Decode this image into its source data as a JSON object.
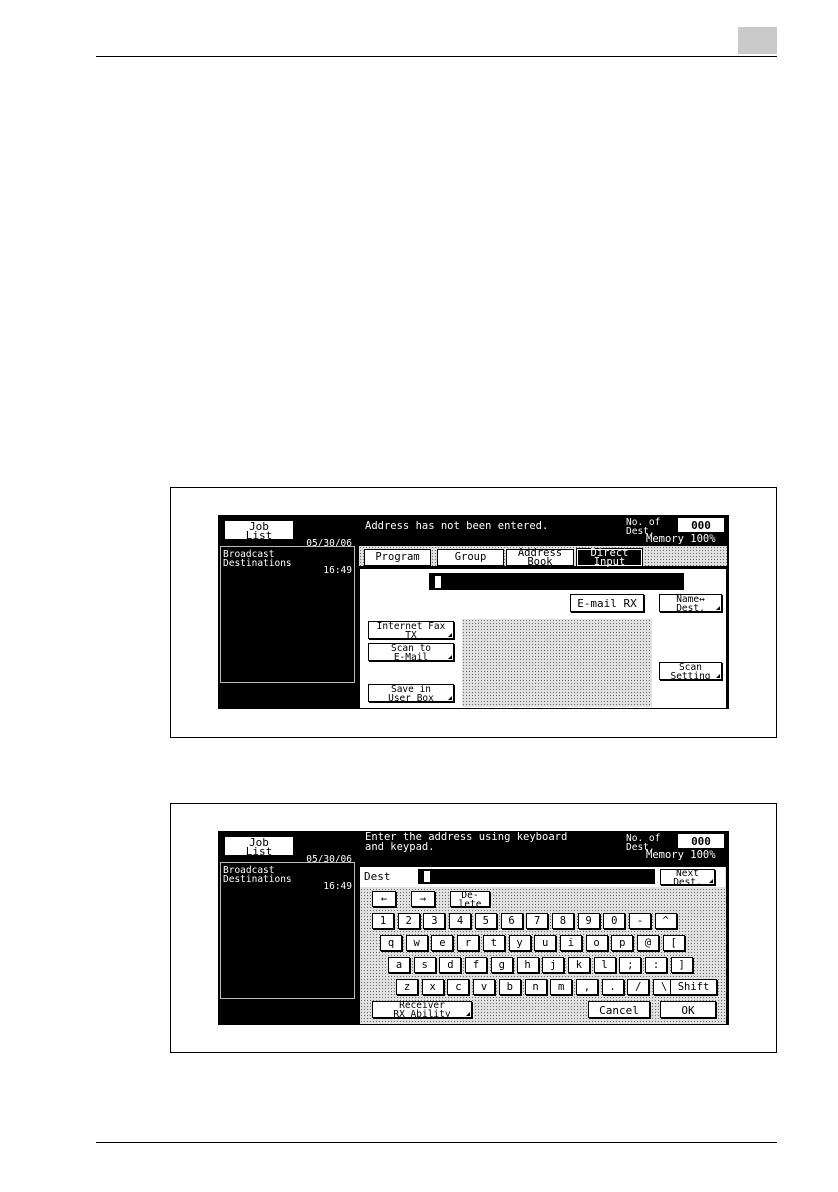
{
  "screen1": {
    "job_list": "Job\nList",
    "date": "05/30/06",
    "time": "16:49",
    "message": "Address has not been entered.",
    "no_of_dest_label": "No. of\nDest.",
    "dest_count": "000",
    "memory": "Memory 100%",
    "destinations_label": "Broadcast\nDestinations",
    "tabs": [
      "Program",
      "Group",
      "Address\nBook",
      "Direct\nInput"
    ],
    "email_rx": "E-mail RX",
    "name_dest": "Name↔\nDest.",
    "internet_fax": "Internet Fax\nTX",
    "scan_to_email": "Scan to\nE-Mail",
    "save_in_user_box": "Save in\nUser Box",
    "scan_setting": "Scan\nSetting"
  },
  "screen2": {
    "job_list": "Job\nList",
    "date": "05/30/06",
    "time": "16:49",
    "message": "Enter the address using keyboard\nand keypad.",
    "no_of_dest_label": "No. of\nDest.",
    "dest_count": "000",
    "memory": "Memory 100%",
    "destinations_label": "Broadcast\nDestinations",
    "dest_label": "Dest",
    "next_dest": "Next\nDest.",
    "left_arrow": "←",
    "right_arrow": "→",
    "delete": "De-\nlete",
    "keyboard_rows": [
      [
        "1",
        "2",
        "3",
        "4",
        "5",
        "6",
        "7",
        "8",
        "9",
        "0",
        "-",
        "^"
      ],
      [
        "q",
        "w",
        "e",
        "r",
        "t",
        "y",
        "u",
        "i",
        "o",
        "p",
        "@",
        "["
      ],
      [
        "a",
        "s",
        "d",
        "f",
        "g",
        "h",
        "j",
        "k",
        "l",
        ";",
        ":",
        "]"
      ],
      [
        "z",
        "x",
        "c",
        "v",
        "b",
        "n",
        "m",
        ",",
        ".",
        "/",
        "\\"
      ]
    ],
    "shift": "Shift",
    "receiver_ability": "Receiver\nRX Ability",
    "cancel": "Cancel",
    "ok": "OK"
  }
}
